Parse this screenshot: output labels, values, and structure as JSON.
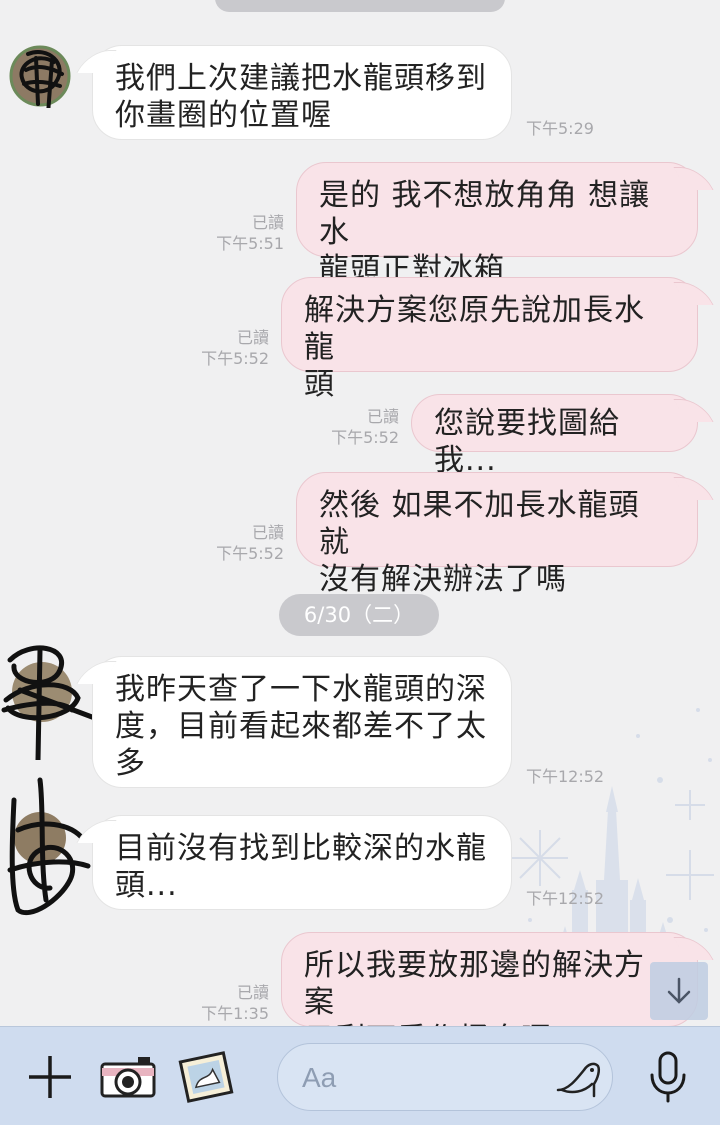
{
  "messages": [
    {
      "text": "我們上次建議把水龍頭移到\n你畫圈的位置喔",
      "time": "下午5:29"
    },
    {
      "text": "是的 我不想放角角 想讓水\n龍頭正對冰箱",
      "read": "已讀",
      "time": "下午5:51"
    },
    {
      "text": "解決方案您原先說加長水龍\n頭",
      "read": "已讀",
      "time": "下午5:52"
    },
    {
      "text": "您說要找圖給我...",
      "read": "已讀",
      "time": "下午5:52"
    },
    {
      "text": "然後 如果不加長水龍頭 就\n沒有解決辦法了嗎",
      "read": "已讀",
      "time": "下午5:52"
    },
    {
      "text": "我昨天查了一下水龍頭的深\n度，目前看起來都差不了太\n多",
      "time": "下午12:52"
    },
    {
      "text": "目前沒有找到比較深的水龍\n頭...",
      "time": "下午12:52"
    },
    {
      "text": "所以我要放那邊的解決方案\n只剩下重作桶身囉?",
      "read": "已讀",
      "time": "下午1:35"
    }
  ],
  "date_separator": "6/30（二）",
  "composer": {
    "placeholder": "Aa"
  },
  "icons": [
    "plus-icon",
    "camera-icon",
    "photo-icon",
    "shoe-sticker-icon",
    "microphone-icon",
    "scroll-down-arrow-icon"
  ],
  "colors": {
    "incoming_bubble": "#ffffff",
    "outgoing_bubble": "#f9e3e8",
    "toolbar": "#cfdcef",
    "background": "#f0f0f1"
  }
}
